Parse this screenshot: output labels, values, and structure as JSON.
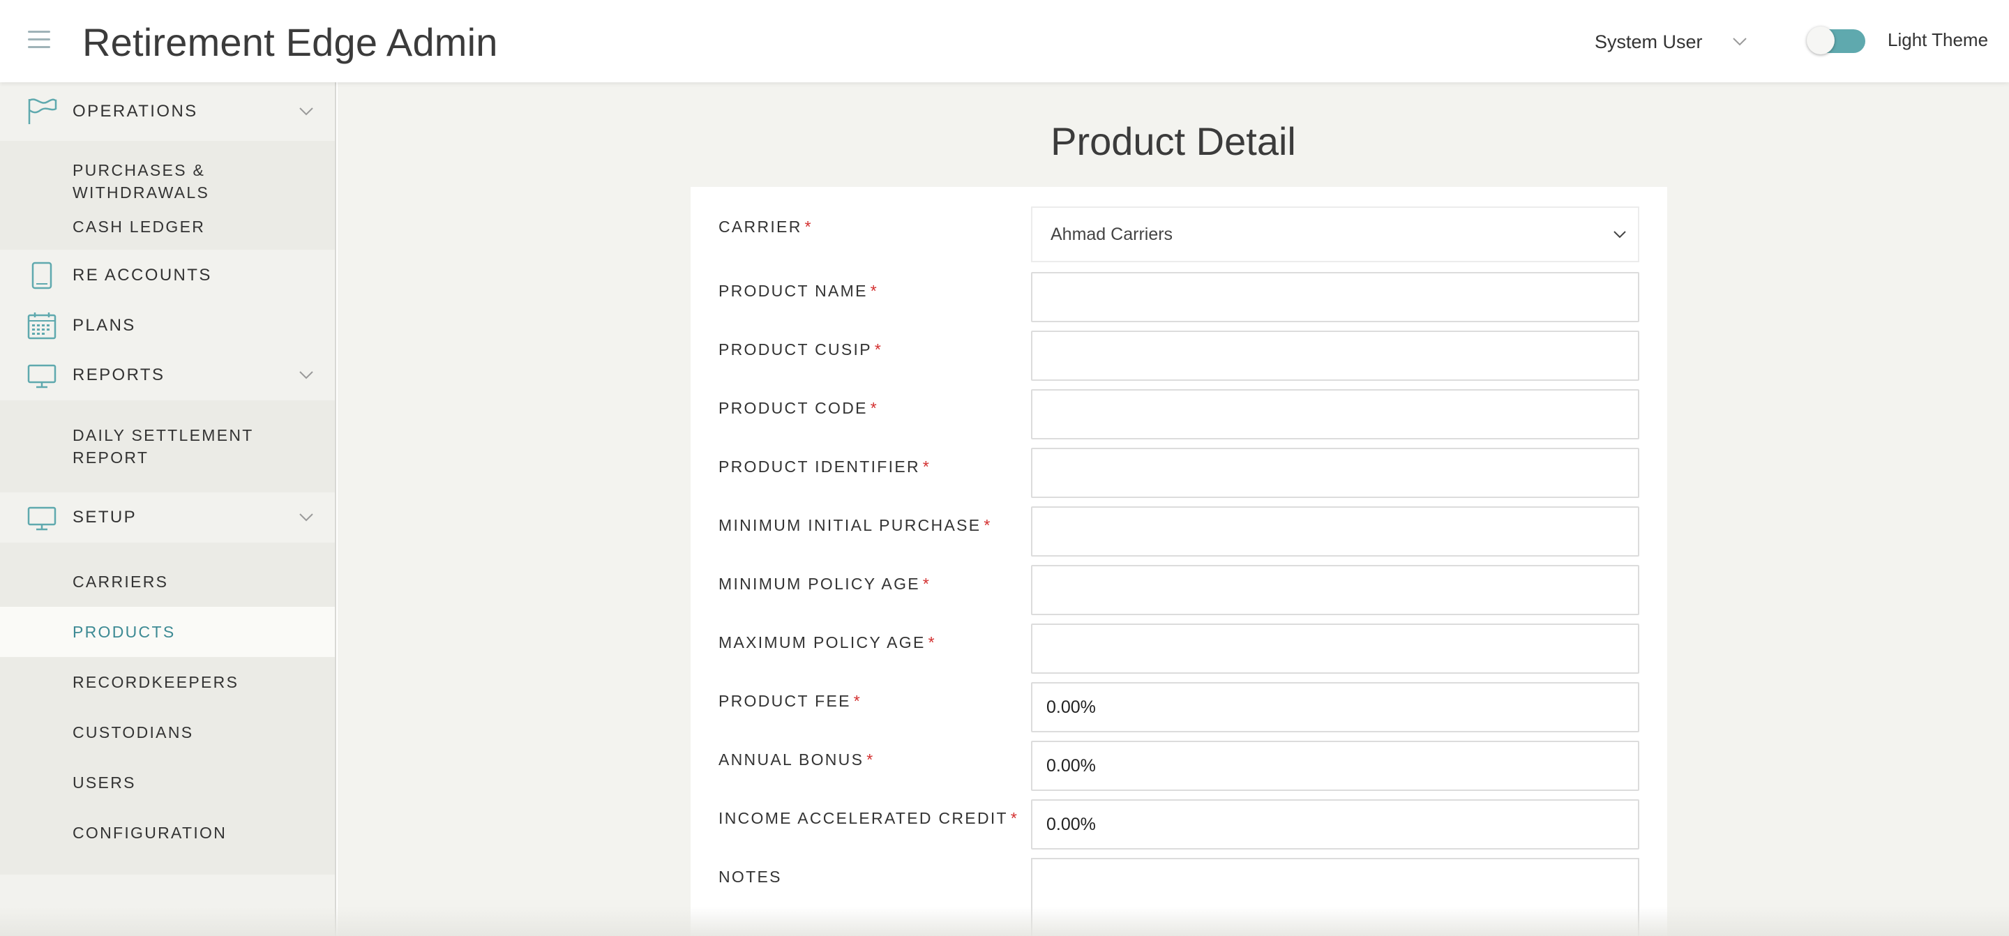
{
  "header": {
    "app_title": "Retirement Edge Admin",
    "user_name": "System User",
    "theme_label": "Light Theme"
  },
  "sidebar": {
    "operations": {
      "label": "OPERATIONS",
      "icon": "flag-icon",
      "items": [
        "PURCHASES & WITHDRAWALS",
        "CASH LEDGER"
      ]
    },
    "re_accounts": {
      "label": "RE ACCOUNTS",
      "icon": "book-icon"
    },
    "plans": {
      "label": "PLANS",
      "icon": "calendar-icon"
    },
    "reports": {
      "label": "REPORTS",
      "icon": "monitor-icon",
      "items": [
        "DAILY SETTLEMENT REPORT"
      ]
    },
    "setup": {
      "label": "SETUP",
      "icon": "monitor-icon",
      "items": [
        "CARRIERS",
        "PRODUCTS",
        "RECORDKEEPERS",
        "CUSTODIANS",
        "USERS",
        "CONFIGURATION"
      ],
      "active_item": "PRODUCTS"
    }
  },
  "main": {
    "page_title": "Product Detail",
    "form": {
      "required_mark": "*",
      "fields": [
        {
          "label": "CARRIER",
          "required": true,
          "type": "select",
          "value": "Ahmad Carriers"
        },
        {
          "label": "PRODUCT NAME",
          "required": true,
          "type": "text",
          "value": ""
        },
        {
          "label": "PRODUCT CUSIP",
          "required": true,
          "type": "text",
          "value": ""
        },
        {
          "label": "PRODUCT CODE",
          "required": true,
          "type": "text",
          "value": ""
        },
        {
          "label": "PRODUCT IDENTIFIER",
          "required": true,
          "type": "text",
          "value": ""
        },
        {
          "label": "MINIMUM INITIAL PURCHASE",
          "required": true,
          "type": "text",
          "value": ""
        },
        {
          "label": "MINIMUM POLICY AGE",
          "required": true,
          "type": "text",
          "value": ""
        },
        {
          "label": "MAXIMUM POLICY AGE",
          "required": true,
          "type": "text",
          "value": ""
        },
        {
          "label": "PRODUCT FEE",
          "required": true,
          "type": "text",
          "value": "0.00%"
        },
        {
          "label": "ANNUAL BONUS",
          "required": true,
          "type": "text",
          "value": "0.00%"
        },
        {
          "label": "INCOME ACCELERATED CREDIT",
          "required": true,
          "type": "text",
          "value": "0.00%"
        },
        {
          "label": "NOTES",
          "required": false,
          "type": "textarea",
          "value": ""
        }
      ]
    }
  },
  "colors": {
    "accent": "#5fa9ae",
    "active_nav": "#3d8a94",
    "required": "#d32f2f",
    "sidebar_bg": "#f2f2ee",
    "main_bg": "#f3f3ef"
  }
}
